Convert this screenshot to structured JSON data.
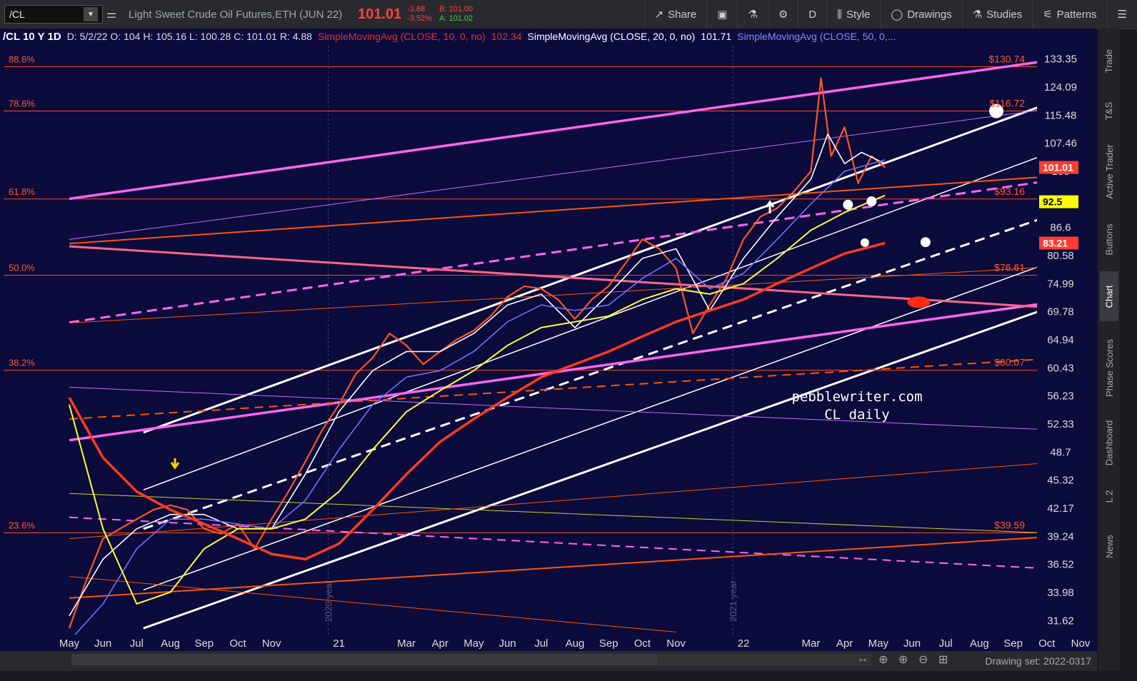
{
  "toolbar": {
    "symbol": "/CL",
    "instrument": "Light Sweet Crude Oil Futures,ETH (JUN 22)",
    "last": "101.01",
    "change": "-3.68",
    "change_pct": "-3.52%",
    "bid": "B: 101.00",
    "ask": "A: 101.02",
    "share": "Share",
    "period": "D",
    "style": "Style",
    "drawings": "Drawings",
    "studies": "Studies",
    "patterns": "Patterns"
  },
  "info": {
    "symbol": "/CL 10 Y 1D",
    "ohlc": "D: 5/2/22  O: 104  H: 105.16  L: 100.28  C: 101.01  R: 4.88",
    "ma10_label": "SimpleMovingAvg (CLOSE, 10, 0, no)",
    "ma10_value": "102.34",
    "ma20_label": "SimpleMovingAvg (CLOSE, 20, 0, no)",
    "ma20_value": "101.71",
    "ma50_label": "SimpleMovingAvg (CLOSE, 50, 0,..."
  },
  "side_tabs": [
    "Trade",
    "T&S",
    "Active Trader",
    "Buttons",
    "Chart",
    "Phase Scores",
    "Dashboard",
    "L 2",
    "News"
  ],
  "drawing_set": "Drawing set: 2022-0317",
  "chart_data": {
    "type": "line",
    "y_scale": "log",
    "ylim": [
      30.5,
      138
    ],
    "y_ticks": [
      133.35,
      124.09,
      115.48,
      107.46,
      100,
      92.5,
      86.6,
      80.58,
      74.99,
      69.78,
      64.94,
      60.43,
      56.23,
      52.33,
      48.7,
      45.32,
      42.17,
      39.24,
      36.52,
      33.98,
      31.62
    ],
    "y_tick_labels": [
      "133.35",
      "124.09",
      "115.48",
      "107.46",
      "100",
      "92.5",
      "86.6",
      "80.58",
      "74.99",
      "69.78",
      "64.94",
      "60.43",
      "56.23",
      "52.33",
      "48.7",
      "45.32",
      "42.17",
      "39.24",
      "36.52",
      "33.98",
      "31.62"
    ],
    "x_labels": [
      "May",
      "Jun",
      "Jul",
      "Aug",
      "Sep",
      "Oct",
      "Nov",
      "21",
      "Mar",
      "Apr",
      "May",
      "Jun",
      "Jul",
      "Aug",
      "Sep",
      "Oct",
      "Nov",
      "22",
      "Mar",
      "Apr",
      "May",
      "Jun",
      "Jul",
      "Aug",
      "Sep",
      "Oct",
      "Nov"
    ],
    "x_index": [
      0,
      1,
      2,
      3,
      4,
      5,
      6,
      8,
      10,
      11,
      12,
      13,
      14,
      15,
      16,
      17,
      18,
      20,
      22,
      23,
      24,
      25,
      26,
      27,
      28,
      29,
      30
    ],
    "year_markers": [
      {
        "label": "2020 year",
        "x": 8
      },
      {
        "label": "2021 year",
        "x": 20
      }
    ],
    "fib_levels": [
      {
        "label": "88.6%",
        "price_label": "$130.74",
        "value": 130.74
      },
      {
        "label": "78.6%",
        "price_label": "$116.72",
        "value": 116.72
      },
      {
        "label": "61.8%",
        "price_label": "$93.16",
        "value": 93.16
      },
      {
        "label": "50.0%",
        "price_label": "$76.61",
        "value": 76.61
      },
      {
        "label": "38.2%",
        "price_label": "$60.07",
        "value": 60.07
      },
      {
        "label": "23.6%",
        "price_label": "$39.59",
        "value": 39.59
      }
    ],
    "price_badges": [
      {
        "label": "101.01",
        "value": 101.01,
        "color": "#ff3b2f"
      },
      {
        "label": "92.5",
        "value": 92.5,
        "color": "#ffff00"
      },
      {
        "label": "83.21",
        "value": 83.21,
        "color": "#ff3b2f"
      }
    ],
    "series": [
      {
        "name": "/CL",
        "color": "#ff5522",
        "x": [
          0,
          0.5,
          1,
          1.5,
          2,
          2.5,
          3,
          3.5,
          4,
          4.5,
          5,
          5.5,
          6,
          6.5,
          7,
          7.5,
          8,
          8.5,
          9,
          9.5,
          10,
          10.5,
          11,
          11.5,
          12,
          12.5,
          13,
          13.5,
          14,
          14.5,
          15,
          15.5,
          16,
          16.5,
          17,
          17.5,
          18,
          18.5,
          19,
          19.5,
          20,
          20.5,
          21,
          21.5,
          22,
          22.3,
          22.6,
          23,
          23.4,
          23.8,
          24.2
        ],
        "values": [
          31,
          35,
          39,
          40,
          41,
          42,
          42.5,
          42,
          40,
          39.5,
          40.5,
          38,
          41,
          44,
          47.5,
          51.5,
          55,
          59.5,
          62,
          66,
          64,
          61,
          63,
          65,
          66.5,
          69,
          72.5,
          74.5,
          74,
          72,
          68.5,
          72,
          74.5,
          79,
          84,
          82,
          78,
          66,
          71,
          76,
          84,
          89,
          91,
          95,
          100,
          127,
          104,
          112,
          97,
          104,
          101
        ]
      },
      {
        "name": "SimpleMovingAvg (CLOSE, 10, 0, no)",
        "color": "#ffffff",
        "x": [
          0,
          1,
          2,
          3,
          4,
          5,
          6,
          7,
          8,
          9,
          10,
          11,
          12,
          13,
          14,
          15,
          16,
          17,
          18,
          19,
          20,
          21,
          22,
          22.5,
          23,
          23.5,
          24.2
        ],
        "values": [
          32,
          37,
          40,
          41.5,
          41.5,
          40,
          40,
          46,
          54,
          60,
          63,
          63,
          66,
          71,
          73,
          67,
          73,
          80,
          82,
          70,
          80,
          89,
          98,
          110,
          102,
          105,
          102
        ]
      },
      {
        "name": "SimpleMovingAvg (CLOSE, 50, 0,...",
        "color": "#7070ff",
        "x": [
          0,
          1,
          2,
          3,
          4,
          5,
          6,
          7,
          8,
          9,
          10,
          11,
          12,
          13,
          14,
          15,
          16,
          17,
          18,
          19,
          20,
          21,
          22,
          23,
          24.2
        ],
        "values": [
          30,
          33,
          38,
          41,
          41,
          40.5,
          40,
          43,
          49,
          55,
          59,
          60,
          63,
          68,
          71,
          70,
          71,
          76,
          80,
          74,
          77,
          84,
          92,
          100,
          103
        ]
      },
      {
        "name": "",
        "color": "#ffff33",
        "x": [
          0,
          1,
          2,
          3,
          4,
          5,
          6,
          7,
          8,
          9,
          10,
          11,
          12,
          13,
          14,
          15,
          16,
          17,
          18,
          19,
          20,
          21,
          22,
          23,
          24.2
        ],
        "values": [
          55,
          40,
          33,
          34,
          38,
          40,
          40,
          41,
          44,
          49,
          54,
          57,
          60,
          64,
          67,
          68,
          69,
          72,
          74,
          73,
          75,
          80,
          86,
          90,
          94
        ]
      },
      {
        "name": "",
        "color": "#ff3b1f",
        "x": [
          0,
          1,
          2,
          3,
          4,
          5,
          6,
          7,
          8,
          9,
          10,
          11,
          12,
          13,
          14,
          15,
          16,
          17,
          18,
          19,
          20,
          21,
          22,
          23,
          24.2
        ],
        "values": [
          56,
          48,
          44,
          42,
          40.5,
          39,
          37.5,
          37,
          38.5,
          42,
          46,
          50,
          53,
          56,
          59,
          61,
          63,
          65.5,
          68,
          70,
          72,
          75,
          78,
          81,
          83.2
        ]
      }
    ],
    "trendlines": [
      {
        "x": [
          2.2,
          31
        ],
        "values": [
          51.2,
          126.5
        ],
        "color": "#ffffff",
        "width": 3,
        "dash": ""
      },
      {
        "x": [
          2.2,
          31
        ],
        "values": [
          44.2,
          111.5
        ],
        "color": "#ffffff",
        "width": 1.5,
        "dash": ""
      },
      {
        "x": [
          2.2,
          31
        ],
        "values": [
          40.0,
          94.5
        ],
        "color": "#ffffff",
        "width": 3,
        "dash": "14,8"
      },
      {
        "x": [
          2.2,
          31
        ],
        "values": [
          34.2,
          84.0
        ],
        "color": "#ffffff",
        "width": 1.5,
        "dash": ""
      },
      {
        "x": [
          2.2,
          31
        ],
        "values": [
          31.0,
          74.8
        ],
        "color": "#ffffff",
        "width": 3,
        "dash": ""
      },
      {
        "x": [
          0,
          31
        ],
        "values": [
          93.2,
          136
        ],
        "color": "#ff66ee",
        "width": 3.5,
        "dash": ""
      },
      {
        "x": [
          0,
          31
        ],
        "values": [
          67.9,
          100
        ],
        "color": "#ff66ee",
        "width": 3,
        "dash": "14,8"
      },
      {
        "x": [
          0,
          31
        ],
        "values": [
          50.2,
          73.1
        ],
        "color": "#ff66ee",
        "width": 3.5,
        "dash": ""
      },
      {
        "x": [
          0,
          31
        ],
        "values": [
          82.5,
          69.8
        ],
        "color": "#ff6688",
        "width": 3,
        "dash": ""
      },
      {
        "x": [
          0,
          31
        ],
        "values": [
          84.0,
          120.0
        ],
        "color": "#cc66ff",
        "width": 1,
        "dash": ""
      },
      {
        "x": [
          0,
          31
        ],
        "values": [
          57.5,
          51.2
        ],
        "color": "#cc66ff",
        "width": 1,
        "dash": ""
      },
      {
        "x": [
          0,
          31
        ],
        "values": [
          41.2,
          35.8
        ],
        "color": "#ff66ee",
        "width": 2,
        "dash": "12,8"
      },
      {
        "x": [
          0,
          31
        ],
        "values": [
          83.1,
          99.8
        ],
        "color": "#ff5500",
        "width": 2,
        "dash": ""
      },
      {
        "x": [
          0,
          31
        ],
        "values": [
          53.0,
          62.5
        ],
        "color": "#ff5500",
        "width": 2,
        "dash": "12,8"
      },
      {
        "x": [
          0,
          31
        ],
        "values": [
          43.8,
          39.3
        ],
        "color": "#cccc33",
        "width": 1,
        "dash": ""
      },
      {
        "x": [
          0,
          31
        ],
        "values": [
          33.5,
          39.6
        ],
        "color": "#ff5500",
        "width": 2,
        "dash": ""
      },
      {
        "x": [
          0,
          31
        ],
        "values": [
          67.8,
          79.0
        ],
        "color": "#ff5500",
        "width": 1,
        "dash": ""
      },
      {
        "x": [
          0,
          31
        ],
        "values": [
          39.0,
          48.0
        ],
        "color": "#ff5500",
        "width": 1,
        "dash": ""
      },
      {
        "x": [
          0,
          18
        ],
        "values": [
          35.4,
          30.7
        ],
        "color": "#ff5500",
        "width": 1,
        "dash": ""
      }
    ],
    "markers": [
      {
        "x": 27.5,
        "value": 116.72,
        "color": "#ffffff",
        "r": 10
      },
      {
        "x": 23.1,
        "value": 91.8,
        "color": "#ffffff",
        "r": 7
      },
      {
        "x": 23.8,
        "value": 92.6,
        "color": "#ffffff",
        "r": 7
      },
      {
        "x": 23.6,
        "value": 83.3,
        "color": "#ffffff",
        "r": 6
      },
      {
        "x": 25.4,
        "value": 83.4,
        "color": "#ffffff",
        "r": 7
      },
      {
        "x": 25.2,
        "value": 71.5,
        "color": "#ff2a10",
        "r": 12
      }
    ],
    "annotation": [
      "pebblewriter.com",
      "CL daily"
    ]
  }
}
